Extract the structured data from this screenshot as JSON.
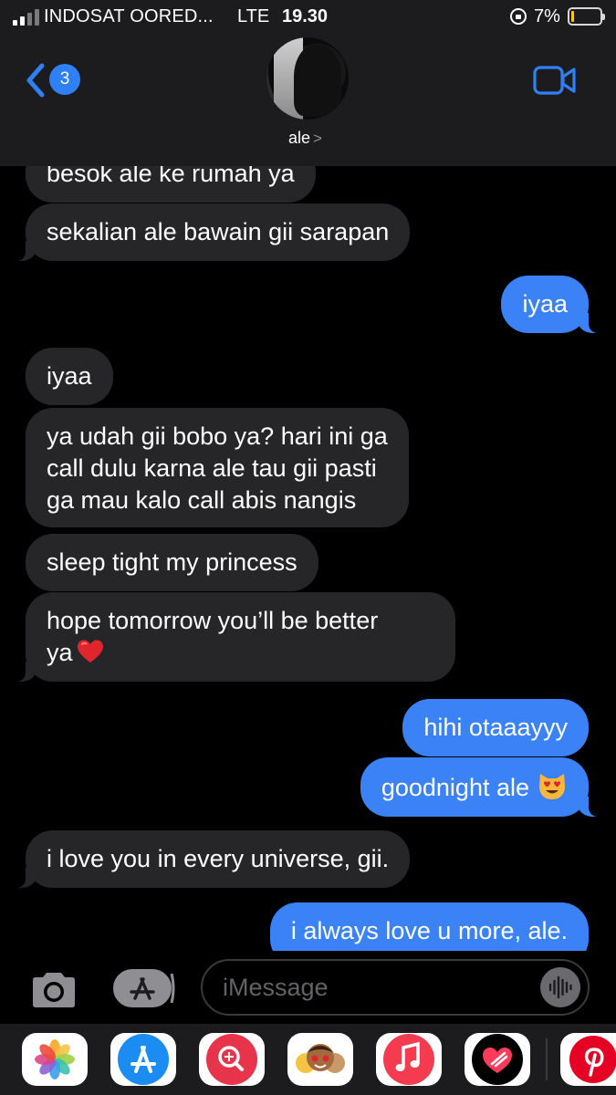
{
  "status_bar": {
    "carrier": "INDOSAT OORED...",
    "network": "LTE",
    "time": "19.30",
    "battery": "7%"
  },
  "header": {
    "back_badge": "3",
    "contact_name": "ale",
    "chevron": ">"
  },
  "messages": [
    {
      "from": "them",
      "text": "besok ale ke rumah ya"
    },
    {
      "from": "them",
      "text": "sekalian ale bawain gii sarapan"
    },
    {
      "from": "me",
      "text": "iyaa"
    },
    {
      "from": "them",
      "text": "iyaa"
    },
    {
      "from": "them",
      "lines": [
        "ya udah gii bobo ya? hari ini ga",
        "call dulu karna ale tau gii pasti",
        "ga mau kalo call abis nangis"
      ]
    },
    {
      "from": "them",
      "text": "sleep tight my princess"
    },
    {
      "from": "them",
      "lines": [
        "hope tomorrow you’ll be better",
        "ya"
      ],
      "emoji": "red-heart"
    },
    {
      "from": "me",
      "text": "hihi otaaayyy"
    },
    {
      "from": "me",
      "text": "goodnight ale",
      "emoji": "heart-eyes-cat"
    },
    {
      "from": "them",
      "text": "i love you in every universe, gii."
    },
    {
      "from": "me",
      "text": "i always love u more, ale."
    }
  ],
  "input": {
    "placeholder": "iMessage",
    "value": ""
  },
  "colors": {
    "sent_bubble": "#3b82f6",
    "received_bubble": "#262629",
    "accent": "#2f7ff6",
    "background": "#000000"
  },
  "app_drawer": {
    "apps": [
      "photos-app-icon",
      "app-store-icon",
      "search-images-icon",
      "memoji-stickers-icon",
      "music-icon",
      "digital-touch-icon",
      "pinterest-icon"
    ]
  }
}
